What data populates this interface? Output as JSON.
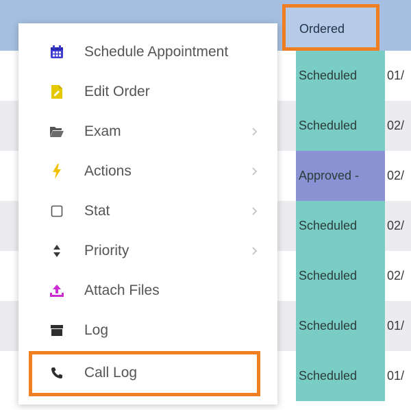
{
  "table": {
    "status_header": "Ordered",
    "rows": [
      {
        "status": "Scheduled",
        "status_kind": "scheduled",
        "date": "01/"
      },
      {
        "status": "Scheduled",
        "status_kind": "scheduled",
        "date": "02/"
      },
      {
        "status": "Approved - ",
        "status_kind": "approved",
        "date": "02/"
      },
      {
        "status": "Scheduled",
        "status_kind": "scheduled",
        "date": "02/"
      },
      {
        "status": "Scheduled",
        "status_kind": "scheduled",
        "date": "02/"
      },
      {
        "status": "Scheduled",
        "status_kind": "scheduled",
        "date": "01/"
      },
      {
        "status": "Scheduled",
        "status_kind": "scheduled",
        "date": "01/"
      }
    ]
  },
  "context_menu": {
    "items": [
      {
        "label": "Schedule Appointment",
        "icon": "calendar-icon",
        "submenu": false
      },
      {
        "label": "Edit Order",
        "icon": "edit-document-icon",
        "submenu": false
      },
      {
        "label": "Exam",
        "icon": "folder-open-icon",
        "submenu": true
      },
      {
        "label": "Actions",
        "icon": "lightning-icon",
        "submenu": true
      },
      {
        "label": "Stat",
        "icon": "checkbox-icon",
        "submenu": true
      },
      {
        "label": "Priority",
        "icon": "sort-icon",
        "submenu": true
      },
      {
        "label": "Attach Files",
        "icon": "upload-icon",
        "submenu": false
      },
      {
        "label": "Log",
        "icon": "archive-icon",
        "submenu": false
      },
      {
        "label": "Call Log",
        "icon": "phone-icon",
        "submenu": false
      }
    ]
  },
  "colors": {
    "header_bg": "#a6bfe0",
    "scheduled_bg": "#79cdc4",
    "approved_bg": "#8b91d3",
    "highlight_border": "#f07f22",
    "calendar_icon": "#3d3dd6",
    "edit_icon": "#e6c800",
    "lightning_icon": "#f2c200",
    "upload_icon": "#cc2bd1"
  }
}
